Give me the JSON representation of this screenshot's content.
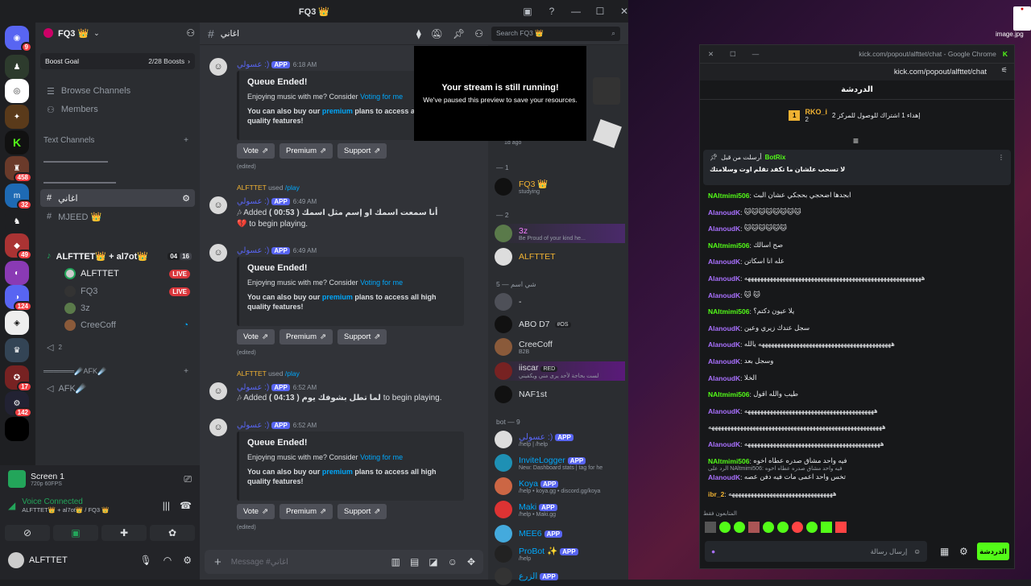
{
  "window": {
    "title": "FQ3 👑"
  },
  "server": {
    "name": "FQ3 👑",
    "boost_goal": "Boost Goal",
    "boosts": "2/28 Boosts"
  },
  "rail_badges": [
    "9",
    "458",
    "32",
    "49",
    "124",
    "17",
    "142"
  ],
  "sidebar": {
    "browse": "Browse Channels",
    "members": "Members",
    "text_channels": "Text Channels",
    "channels": [
      {
        "name": "اغاني"
      },
      {
        "name": "MJEED 👑"
      }
    ],
    "voice_channel": "ALFTTET👑 + al7ot👑",
    "voice_count_a": "04",
    "voice_count_b": "16",
    "voice_users": [
      {
        "name": "ALFTTET",
        "live": "LIVE"
      },
      {
        "name": "FQ3",
        "live": "LIVE"
      },
      {
        "name": "3z",
        "live": ""
      },
      {
        "name": "CreeCoff",
        "live": ""
      }
    ],
    "voice2_count": "2",
    "afk_header": "══════☄️AFK☄️",
    "afk": "AFK☄️"
  },
  "user_panel": {
    "screen_title": "Screen 1",
    "screen_sub": "720p 60FPS",
    "voice_status": "Voice Connected",
    "voice_sub": "ALFTTET👑 + al7ot👑 / FQ3 👑",
    "username": "ALFTTET"
  },
  "chat": {
    "channel": "اغاني",
    "search_placeholder": "Search FQ3 👑",
    "composer_placeholder": "Message #اغاني",
    "messages": [
      {
        "user": "عسولي :)",
        "time": "6:18 AM",
        "embed_title": "Queue Ended!",
        "embed_desc": "Enjoying music with me? Consider",
        "embed_link": "Voting for me",
        "embed_extra_a": "You can also buy our",
        "embed_extra_link": "premium",
        "embed_extra_b": "plans to access all high quality features!",
        "edited": "(edited)"
      },
      {
        "used_by": "ALFTTET",
        "used": "used",
        "cmd": "/play",
        "user": "عسولي :)",
        "time": "6:49 AM",
        "added": "Added",
        "duration": "( 00:53 )",
        "song": "أنا سمعت اسمك او إسم مثل اسمك 💔",
        "tail": "to begin playing."
      },
      {
        "user": "عسولي :)",
        "time": "6:49 AM",
        "embed_title": "Queue Ended!",
        "embed_desc": "Enjoying music with me? Consider",
        "embed_link": "Voting for me",
        "embed_extra_a": "You can also buy our",
        "embed_extra_link": "premium",
        "embed_extra_b": "plans to access all high quality features!",
        "edited": "(edited)"
      },
      {
        "used_by": "ALFTTET",
        "used": "used",
        "cmd": "/play",
        "user": "عسولي :)",
        "time": "6:52 AM",
        "added": "Added",
        "duration": "( 04:13 )",
        "song": "لما تطل بشوفك يوم",
        "tail": "to begin playing."
      },
      {
        "user": "عسولي :)",
        "time": "6:52 AM",
        "embed_title": "Queue Ended!",
        "embed_desc": "Enjoying music with me? Consider",
        "embed_link": "Voting for me",
        "embed_extra_a": "You can also buy our",
        "embed_extra_link": "premium",
        "embed_extra_b": "plans to access all high quality features!",
        "edited": "(edited)"
      }
    ],
    "buttons": {
      "vote": "Vote",
      "premium": "Premium",
      "support": "Support"
    },
    "app": "APP"
  },
  "overlay": {
    "title": "Your stream is still running!",
    "sub": "We've paused this preview to save your resources."
  },
  "members": {
    "ago": "1d ago",
    "groups": [
      {
        "label": "— 1",
        "items": [
          {
            "name": "FQ3 👑",
            "status": "studying"
          }
        ]
      },
      {
        "label": "— 2",
        "items": [
          {
            "name": "3z",
            "status": "Be Proud of your kind he..."
          },
          {
            "name": "ALFTTET",
            "status": ""
          }
        ]
      },
      {
        "label": "5 — شي اسم",
        "items": [
          {
            "name": "-",
            "status": ""
          },
          {
            "name": "ABO D7",
            "status": "",
            "tag": "#OS"
          },
          {
            "name": "CreeCoff",
            "status": "B2B"
          },
          {
            "name": "iiscar",
            "status": "لست بحاجة لأحد يرى مني ويكفيني",
            "tag": "RED"
          },
          {
            "name": "NAF1st",
            "status": ""
          }
        ]
      },
      {
        "label": "bot — 9",
        "items": [
          {
            "name": "عسولي :)",
            "status": "/help | /help",
            "app": "APP"
          },
          {
            "name": "InviteLogger",
            "status": "New: Dashboard stats | tag for he",
            "app": "APP"
          },
          {
            "name": "Koya",
            "status": "/help • koya.gg • discord.gg/koya",
            "app": "APP"
          },
          {
            "name": "Maki",
            "status": "/help • Maki.gg",
            "app": "APP"
          },
          {
            "name": "MEE6",
            "status": "",
            "app": "APP"
          },
          {
            "name": "ProBot ✨",
            "status": "/help",
            "app": "APP"
          },
          {
            "name": "الزرع",
            "status": "",
            "app": "APP"
          }
        ]
      }
    ]
  },
  "chrome": {
    "title": "kick.com/popout/alfttet/chat - Google Chrome",
    "url": "kick.com/popout/alfttet/chat",
    "tab": "الدردشة",
    "leader_name": "RKO_i",
    "leader_count": "2",
    "leader_text": "إهداء 1 اشتراك للوصول للمركز 2",
    "pinned_by": "أرسلت من قبل",
    "pinned_user": "BotRix",
    "pinned_text": "لا تسحب علشان ما تكفد تقلم اوت وسلامتك",
    "lines": [
      {
        "user": "NAltmimi506",
        "text": "ابجدها اضحجي بحجكي عشان البث"
      },
      {
        "user": "AlanoudK",
        "text": "🐱🐱🐱🐱🐱🐱🐱🐱"
      },
      {
        "user": "AlanoudK",
        "text": "🐱🐱🐱🐱🐱🐱"
      },
      {
        "user": "NAltmimi506",
        "text": "صح اسالك"
      },
      {
        "user": "AlanoudK",
        "text": "عله انا اسكاتن"
      },
      {
        "user": "AlanoudK",
        "text": "ههههههههههههههههههههههههههههههههههههههههههههههههههههههههه"
      },
      {
        "user": "AlanoudK",
        "text": "🐱 🐱"
      },
      {
        "user": "NAltmimi506",
        "text": "يلا عيون دكتم؟"
      },
      {
        "user": "AlanoudK",
        "text": "سجل عندك زيري وعين"
      },
      {
        "user": "AlanoudK",
        "text": "ههههههههههههههههههههههههههههههههههههههههههه يالله"
      },
      {
        "user": "AlanoudK",
        "text": "وسجل بعد"
      },
      {
        "user": "AlanoudK",
        "text": "الخلا"
      },
      {
        "user": "NAltmimi506",
        "text": "طيب والله اقول"
      },
      {
        "user": "AlanoudK",
        "text": "هههههههههههههههههههههههههههههههههههههههههه"
      },
      {
        "user": "",
        "text": "هههههههههههههههههههههههههههههههههههههههههههههههههههههههه"
      },
      {
        "user": "AlanoudK",
        "text": "هههههههههههههههههههههههههههههههههههههههههههه"
      },
      {
        "user": "NAltmimi506",
        "text": "فيه واحد مشاق صدره عطاه اخوه"
      },
      {
        "user": "AlanoudK",
        "text": "تخس واحد اعمى مات فيه دفن عصه",
        "reply": "الرد على NAltmimi506: فيه واحد مشاق صدره عطاه اخوه"
      },
      {
        "user": "ibr_2",
        "text": "هههههههههههههههههههههههههههههههههه"
      }
    ],
    "emote_label": "المتابعون فقط",
    "input_placeholder": "إرسال رسالة",
    "send": "الدردشة"
  },
  "desktop": {
    "file": "image.jpg"
  }
}
